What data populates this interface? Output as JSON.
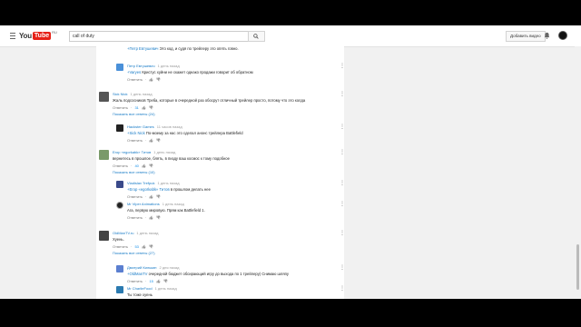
{
  "header": {
    "logo_you": "You",
    "logo_tube": "Tube",
    "logo_region": "RU",
    "search_value": "call of duty",
    "add_video_label": "Добавить видео"
  },
  "comments": [
    {
      "type": "reply",
      "text_prefix": "+Петр Евтушевич",
      "text": " Это код, и судя по трейлеру это опять говно.",
      "show_author": false
    },
    {
      "type": "reply",
      "author": "Петр Евтушевич",
      "time": "1 день назад",
      "text_prefix": "+Varyes",
      "text": " Кристус хуйни не скажет однако продажи говорит об обратном",
      "reply_label": "Ответить",
      "likes": ""
    },
    {
      "type": "top",
      "author": "Sick Nick",
      "time": "1 день назад",
      "text": "Жаль подсосников Треба, которые в очередной раз обосрут отличный трейлер просто, потому что это колда",
      "reply_label": "Ответить",
      "likes": "31",
      "show_replies": "Показать все ответы (24)"
    },
    {
      "type": "reply",
      "author": "Hackster Games",
      "time": "11 часов назад",
      "text_prefix": "+Sick Nick",
      "text": " По-моему за нас это сделал анонс трейлера Battlefield",
      "reply_label": "Ответить",
      "likes": ""
    },
    {
      "type": "top",
      "author": "Егор «egorkabk» Титов",
      "time": "1 день назад",
      "text": "вернитесь в прошлое, блять, в пизду ваш космос к тому подобное",
      "reply_label": "Ответить",
      "likes": "40",
      "show_replies": "Показать все ответы (10)"
    },
    {
      "type": "reply",
      "author": "Vladislav Trefpuk",
      "time": "1 день назад",
      "text_prefix": "+Егор «egorkabk» Титов",
      "text": " в прошлом делать нее",
      "reply_label": "Ответить",
      "likes": ""
    },
    {
      "type": "reply",
      "author": "Mr Viper Animations",
      "time": "1 день назад",
      "text": "Ага, первую мировую. Прям как Battlefield 1.",
      "reply_label": "Ответить",
      "likes": ""
    },
    {
      "type": "top",
      "author": "OldManTV.ru",
      "time": "1 день назад",
      "text": "Хуень.",
      "reply_label": "Ответить",
      "likes": "53",
      "show_replies": "Показать все ответы (27)"
    },
    {
      "type": "reply",
      "author": "Дмитрий Килькин",
      "time": "2 дня назад",
      "text_prefix": "+OldManTV",
      "text": " очередной бюджет обсирающий игру до выхода по 1 трейлеру) Снимаю шляпу",
      "reply_label": "Ответить",
      "likes": "15"
    },
    {
      "type": "reply",
      "author": "Mr CharlieFood",
      "time": "1 день назад",
      "text": "Ты тоже хуень",
      "reply_label": "",
      "likes": ""
    }
  ],
  "colors": {
    "link": "#167ac6",
    "like_count": "#128ee9",
    "logo_red": "#e62117"
  }
}
